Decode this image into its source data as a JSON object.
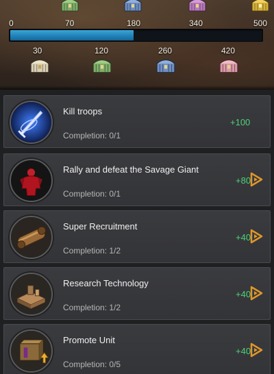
{
  "milestones": {
    "top_labels": [
      "0",
      "70",
      "180",
      "340",
      "500"
    ],
    "bottom_labels": [
      "30",
      "120",
      "260",
      "420"
    ],
    "progress_fraction": 0.49
  },
  "tasks": [
    {
      "title": "Kill troops",
      "progress": "Completion: 0/1",
      "reward": "+100",
      "icon": "ice-sword-icon",
      "has_go": false
    },
    {
      "title": "Rally and defeat the Savage Giant",
      "progress": "Completion: 0/1",
      "reward": "+80",
      "icon": "red-giant-icon",
      "has_go": true
    },
    {
      "title": "Super Recruitment",
      "progress": "Completion: 1/2",
      "reward": "+40",
      "icon": "recruitment-scroll-icon",
      "has_go": true
    },
    {
      "title": "Research Technology",
      "progress": "Completion: 1/2",
      "reward": "+40",
      "icon": "research-building-icon",
      "has_go": true
    },
    {
      "title": "Promote Unit",
      "progress": "Completion: 0/5",
      "reward": "+40",
      "icon": "promote-unit-icon",
      "has_go": true
    }
  ],
  "colors": {
    "progress_fill": "#1f7fb5",
    "reward_green": "#4ed27a",
    "go_button": "#e0962a"
  }
}
